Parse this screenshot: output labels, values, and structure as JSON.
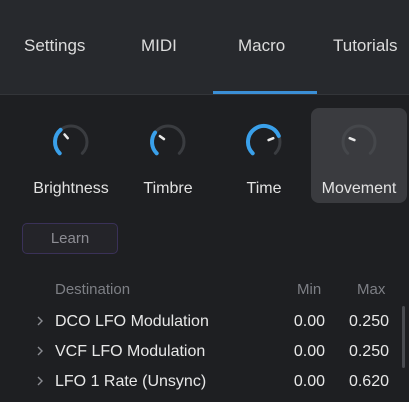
{
  "tabs": [
    {
      "label": "Settings",
      "active": false
    },
    {
      "label": "MIDI",
      "active": false
    },
    {
      "label": "Macro",
      "active": true
    },
    {
      "label": "Tutorials",
      "active": false
    }
  ],
  "macros": [
    {
      "label": "Brightness",
      "value": 0.35,
      "active": true
    },
    {
      "label": "Timbre",
      "value": 0.3,
      "active": true
    },
    {
      "label": "Time",
      "value": 0.75,
      "active": true
    },
    {
      "label": "Movement",
      "value": 0.25,
      "active": false,
      "selected": true
    }
  ],
  "learn_label": "Learn",
  "table": {
    "headers": {
      "destination": "Destination",
      "min": "Min",
      "max": "Max"
    },
    "rows": [
      {
        "destination": "DCO LFO Modulation",
        "min": "0.00",
        "max": "0.250"
      },
      {
        "destination": "VCF LFO Modulation",
        "min": "0.00",
        "max": "0.250"
      },
      {
        "destination": "LFO 1 Rate (Unsync)",
        "min": "0.00",
        "max": "0.620"
      }
    ]
  },
  "colors": {
    "accent": "#3aa0ea",
    "tab_underline": "#3b8fd6",
    "background": "#1e1f22",
    "tab_bar": "#27292d"
  }
}
